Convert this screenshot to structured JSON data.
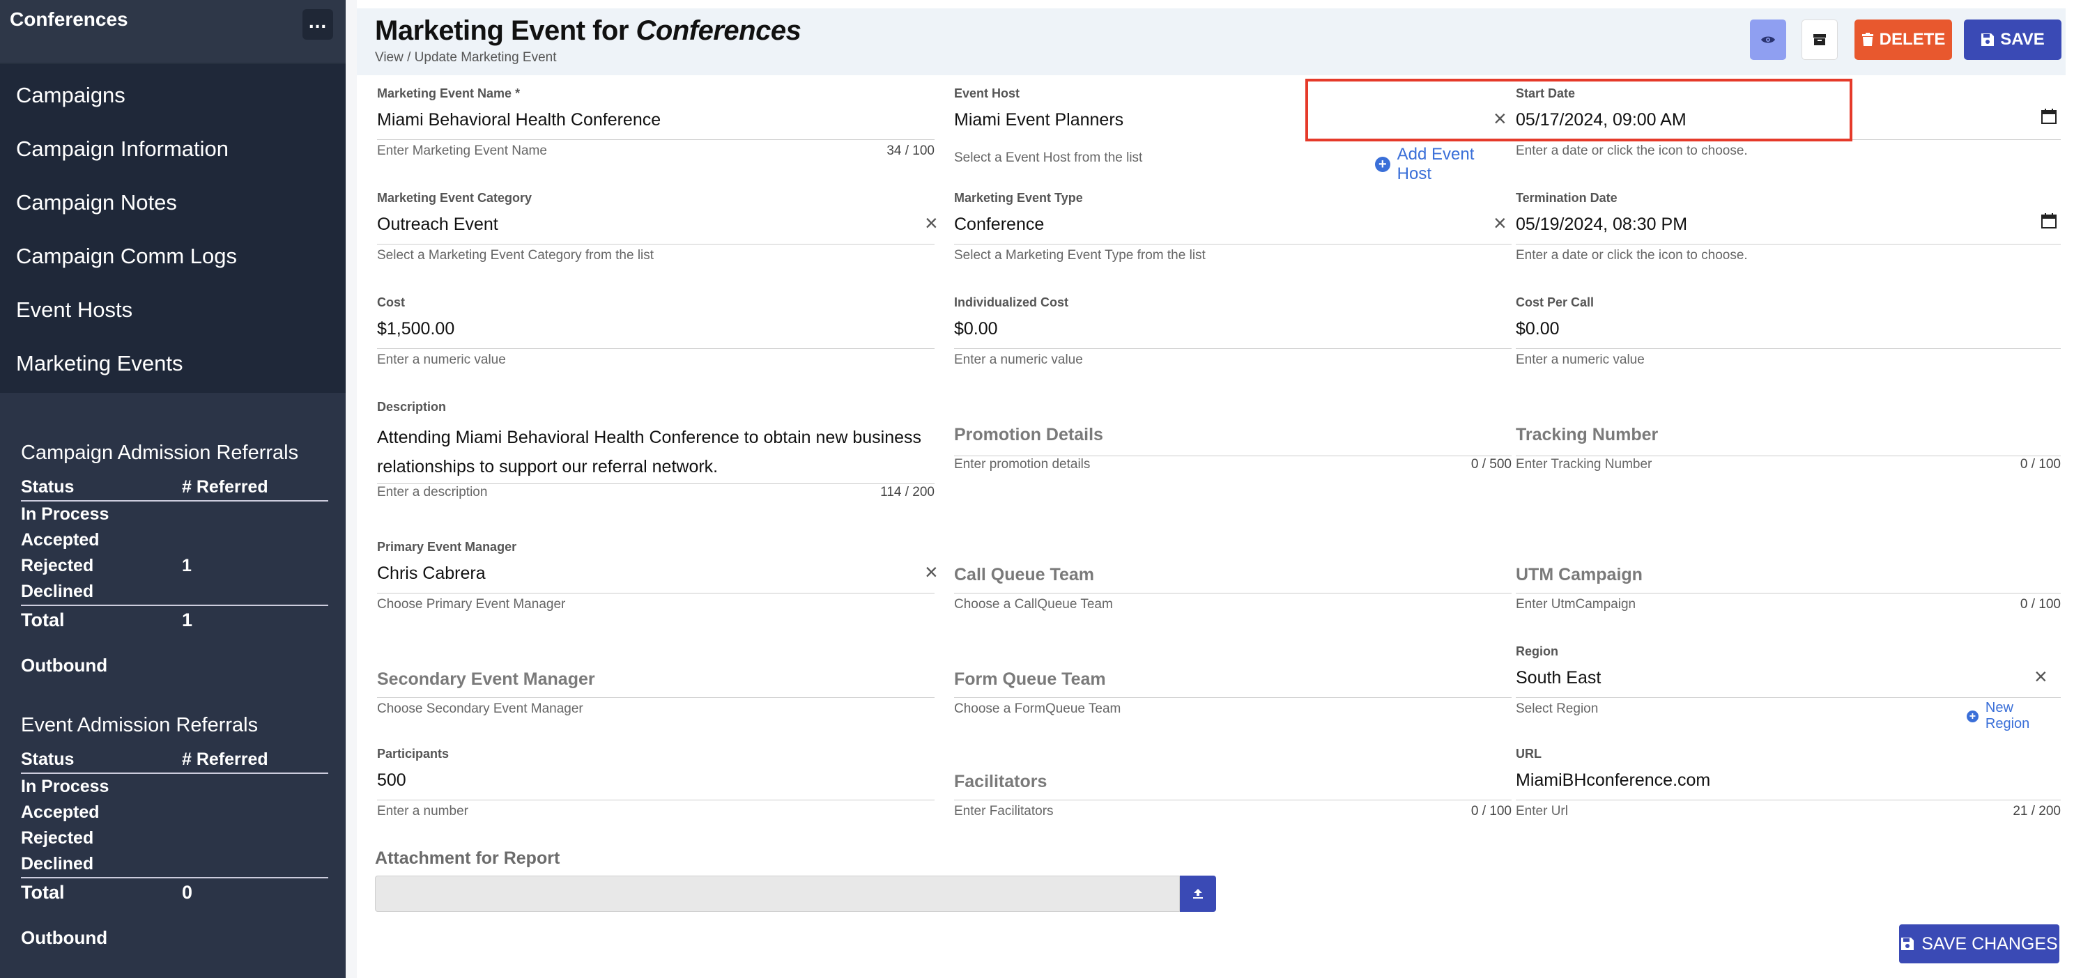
{
  "sidebar": {
    "title": "Conferences",
    "more_label": "...",
    "nav": [
      {
        "label": "Campaigns"
      },
      {
        "label": "Campaign Information"
      },
      {
        "label": "Campaign Notes"
      },
      {
        "label": "Campaign Comm Logs"
      },
      {
        "label": "Event Hosts"
      },
      {
        "label": "Marketing Events"
      }
    ],
    "campaign_referrals": {
      "title": "Campaign Admission Referrals",
      "col_status": "Status",
      "col_referred": "# Referred",
      "rows": [
        {
          "status": "In Process",
          "count": ""
        },
        {
          "status": "Accepted",
          "count": ""
        },
        {
          "status": "Rejected",
          "count": "1"
        },
        {
          "status": "Declined",
          "count": ""
        }
      ],
      "total_label": "Total",
      "total_value": "1",
      "outbound": "Outbound"
    },
    "event_referrals": {
      "title": "Event Admission Referrals",
      "col_status": "Status",
      "col_referred": "# Referred",
      "rows": [
        {
          "status": "In Process",
          "count": ""
        },
        {
          "status": "Accepted",
          "count": ""
        },
        {
          "status": "Rejected",
          "count": ""
        },
        {
          "status": "Declined",
          "count": ""
        }
      ],
      "total_label": "Total",
      "total_value": "0",
      "outbound": "Outbound"
    }
  },
  "header": {
    "title_prefix": "Marketing Event for ",
    "title_campaign": "Conferences",
    "subtitle": "View / Update Marketing Event",
    "delete_label": "DELETE",
    "save_label": "SAVE"
  },
  "form": {
    "name": {
      "label": "Marketing Event Name",
      "required": "*",
      "value": "Miami Behavioral Health Conference",
      "hint": "Enter Marketing Event Name",
      "count": "34 / 100"
    },
    "host": {
      "label": "Event Host",
      "value": "Miami Event Planners",
      "hint": "Select a Event Host from the list",
      "add_label": "Add Event Host"
    },
    "start_date": {
      "label": "Start Date",
      "value": "05/17/2024, 09:00 AM",
      "hint": "Enter a date or click the icon to choose."
    },
    "category": {
      "label": "Marketing Event Category",
      "value": "Outreach Event",
      "hint": "Select a Marketing Event Category from the list"
    },
    "type": {
      "label": "Marketing Event Type",
      "value": "Conference",
      "hint": "Select a Marketing Event Type from the list"
    },
    "termination_date": {
      "label": "Termination Date",
      "value": "05/19/2024, 08:30 PM",
      "hint": "Enter a date or click the icon to choose."
    },
    "cost": {
      "label": "Cost",
      "value": "$1,500.00",
      "hint": "Enter a numeric value"
    },
    "individualized_cost": {
      "label": "Individualized Cost",
      "value": "$0.00",
      "hint": "Enter a numeric value"
    },
    "cost_per_call": {
      "label": "Cost Per Call",
      "value": "$0.00",
      "hint": "Enter a numeric value"
    },
    "description": {
      "label": "Description",
      "line1": "Attending Miami Behavioral Health Conference to obtain new business",
      "line2": "relationships to support our referral network.",
      "hint": "Enter a description",
      "count": "114 / 200"
    },
    "promotion": {
      "placeholder": "Promotion Details",
      "hint": "Enter promotion details",
      "count": "0 / 500"
    },
    "tracking": {
      "placeholder": "Tracking Number",
      "hint": "Enter Tracking Number",
      "count": "0 / 100"
    },
    "primary_manager": {
      "label": "Primary Event Manager",
      "value": "Chris Cabrera",
      "hint": "Choose Primary Event Manager"
    },
    "call_queue": {
      "placeholder": "Call Queue Team",
      "hint": "Choose a CallQueue Team"
    },
    "utm": {
      "placeholder": "UTM Campaign",
      "hint": "Enter UtmCampaign",
      "count": "0 / 100"
    },
    "secondary_manager": {
      "placeholder": "Secondary Event Manager",
      "hint": "Choose Secondary Event Manager"
    },
    "form_queue": {
      "placeholder": "Form Queue Team",
      "hint": "Choose a FormQueue Team"
    },
    "region": {
      "label": "Region",
      "value": "South East",
      "hint": "Select Region",
      "add_label": "New Region"
    },
    "participants": {
      "label": "Participants",
      "value": "500",
      "hint": "Enter a number"
    },
    "facilitators": {
      "placeholder": "Facilitators",
      "hint": "Enter Facilitators",
      "count": "0 / 100"
    },
    "url": {
      "label": "URL",
      "value": "MiamiBHconference.com",
      "hint": "Enter Url",
      "count": "21 / 200"
    },
    "attachment_label": "Attachment for Report",
    "save_changes_label": "SAVE CHANGES"
  },
  "colors": {
    "sidebar_bg": "#2b3447",
    "primary": "#3a4ab5",
    "danger": "#e8582e",
    "highlight": "#e53a2a",
    "link": "#3a6fd8"
  }
}
